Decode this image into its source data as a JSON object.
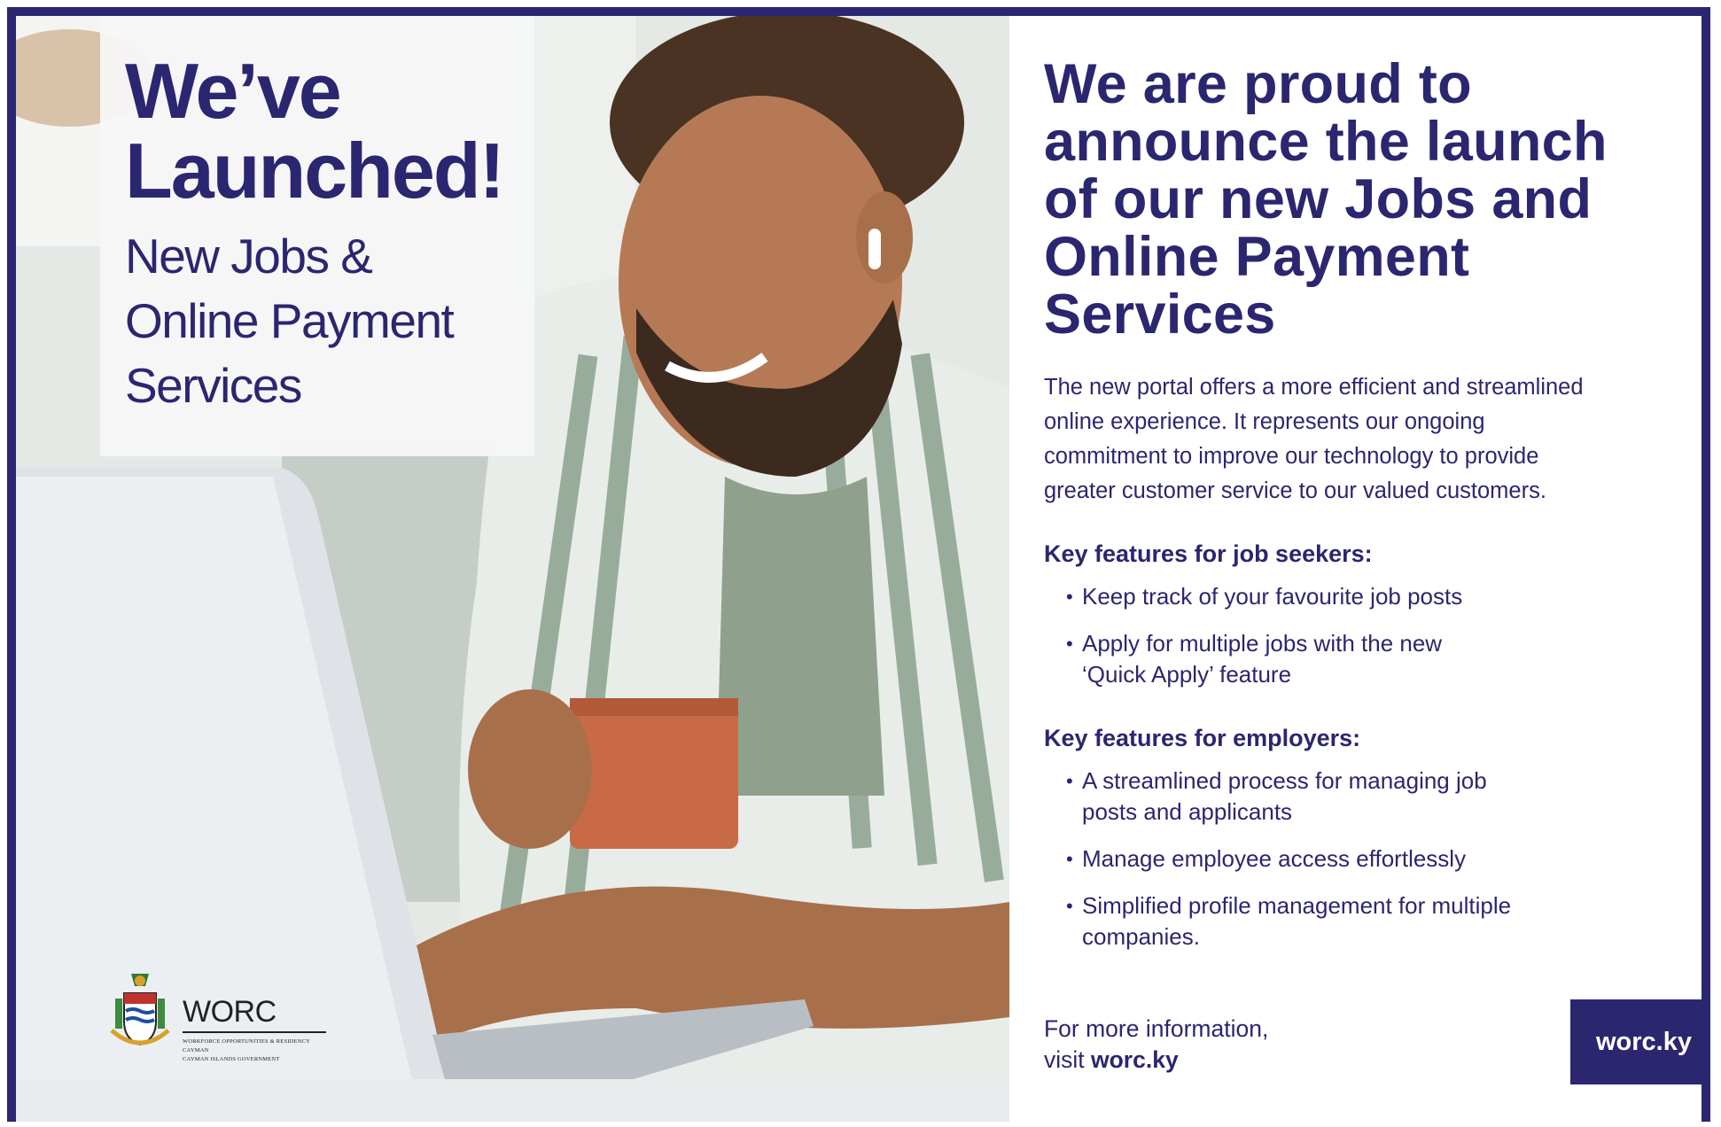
{
  "hero": {
    "headline": "We’ve\nLaunched!",
    "subheadline": "New Jobs &\nOnline Payment\nServices"
  },
  "logo": {
    "name": "WORC",
    "line1": "WORKFORCE OPPORTUNITIES & RESIDENCY CAYMAN",
    "line2": "CAYMAN ISLANDS GOVERNMENT"
  },
  "content": {
    "title": "We are proud to\nannounce the launch\nof our new Jobs and\nOnline Payment\nServices",
    "intro": "The new portal offers a more efficient and streamlined\nonline experience. It represents our ongoing\ncommitment to improve our technology to provide\ngreater customer service to our valued customers.",
    "job_seekers": {
      "heading": "Key features for job seekers:",
      "items": [
        "Keep track of your favourite job posts",
        "Apply for multiple jobs with the new\n‘Quick Apply’ feature"
      ]
    },
    "employers": {
      "heading": "Key features for employers:",
      "items": [
        "A streamlined process for managing job\nposts and applicants",
        "Manage employee access effortlessly",
        "Simplified profile management for multiple\ncompanies."
      ]
    },
    "more_info_line1": "For more information,",
    "more_info_prefix": "visit ",
    "more_info_link": "worc.ky"
  },
  "cta": {
    "label": "worc.ky"
  },
  "colors": {
    "brand": "#2b2670",
    "background": "#ffffff"
  }
}
